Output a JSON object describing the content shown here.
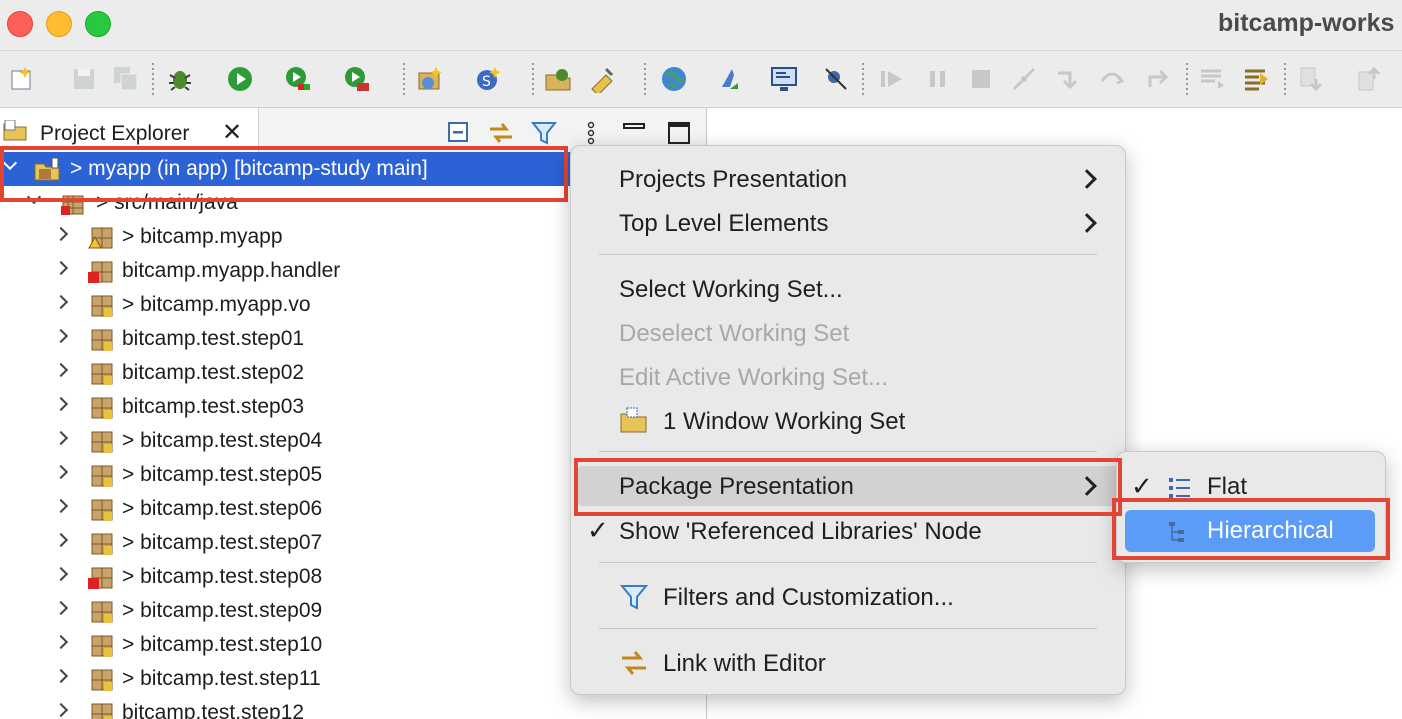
{
  "window": {
    "title": "bitcamp-works"
  },
  "toolbar": {
    "icons": [
      "new-icon",
      "save-icon",
      "save-all-icon",
      "debug-icon",
      "run-icon",
      "coverage-icon",
      "run-external-tools-icon",
      "new-java-project-icon",
      "new-java-class-icon",
      "open-type-icon",
      "search-icon",
      "web-browser-icon",
      "java-icon",
      "console-icon",
      "skip-breakpoints-icon",
      "resume-icon",
      "suspend-icon",
      "terminate-icon",
      "disconnect-icon",
      "step-into-icon",
      "step-over-icon",
      "step-return-icon",
      "drop-to-frame-icon",
      "use-step-filters-icon",
      "next-annotation-icon",
      "previous-annotation-icon"
    ]
  },
  "explorer": {
    "tab_label": "Project Explorer",
    "close_glyph": "✕",
    "tree": [
      {
        "text": "> myapp (in app) [bitcamp-study main]",
        "icon": "project-icon",
        "selected": true
      },
      {
        "text": "> src/main/java",
        "icon": "source-folder-icon"
      },
      {
        "text": "> bitcamp.myapp",
        "icon": "package-warning-icon"
      },
      {
        "text": "bitcamp.myapp.handler",
        "icon": "package-error-icon"
      },
      {
        "text": "> bitcamp.myapp.vo",
        "icon": "package-icon"
      },
      {
        "text": "bitcamp.test.step01",
        "icon": "package-icon"
      },
      {
        "text": "bitcamp.test.step02",
        "icon": "package-icon"
      },
      {
        "text": "bitcamp.test.step03",
        "icon": "package-icon"
      },
      {
        "text": "> bitcamp.test.step04",
        "icon": "package-icon"
      },
      {
        "text": "> bitcamp.test.step05",
        "icon": "package-icon"
      },
      {
        "text": "> bitcamp.test.step06",
        "icon": "package-icon"
      },
      {
        "text": "> bitcamp.test.step07",
        "icon": "package-icon"
      },
      {
        "text": "> bitcamp.test.step08",
        "icon": "package-error-icon"
      },
      {
        "text": "> bitcamp.test.step09",
        "icon": "package-icon"
      },
      {
        "text": "> bitcamp.test.step10",
        "icon": "package-icon"
      },
      {
        "text": "> bitcamp.test.step11",
        "icon": "package-icon"
      },
      {
        "text": "bitcamp.test.step12",
        "icon": "package-icon"
      }
    ]
  },
  "menu": {
    "items": [
      {
        "label": "Projects Presentation",
        "submenu": true,
        "enabled": true
      },
      {
        "label": "Top Level Elements",
        "submenu": true,
        "enabled": true
      },
      {
        "label": "Select Working Set...",
        "enabled": true
      },
      {
        "label": "Deselect Working Set",
        "enabled": false
      },
      {
        "label": "Edit Active Working Set...",
        "enabled": false
      },
      {
        "label": "1 Window Working Set",
        "enabled": true,
        "icon": "working-set-icon"
      },
      {
        "label": "Package Presentation",
        "submenu": true,
        "enabled": true,
        "highlighted": true
      },
      {
        "label": "Show 'Referenced Libraries' Node",
        "enabled": true,
        "checked": true
      },
      {
        "label": "Filters and Customization...",
        "enabled": true,
        "icon": "filter-icon"
      },
      {
        "label": "Link with Editor",
        "enabled": true,
        "icon": "link-editor-icon"
      }
    ],
    "check_glyph": "✓"
  },
  "submenu": {
    "items": [
      {
        "label": "Flat",
        "checked": true,
        "icon": "flat-layout-icon"
      },
      {
        "label": "Hierarchical",
        "checked": false,
        "highlighted": true,
        "icon": "hierarchical-layout-icon"
      }
    ]
  },
  "colors": {
    "selection": "#2b62d6",
    "menu_hover": "#5a9cf8",
    "annotation": "#e34534"
  }
}
